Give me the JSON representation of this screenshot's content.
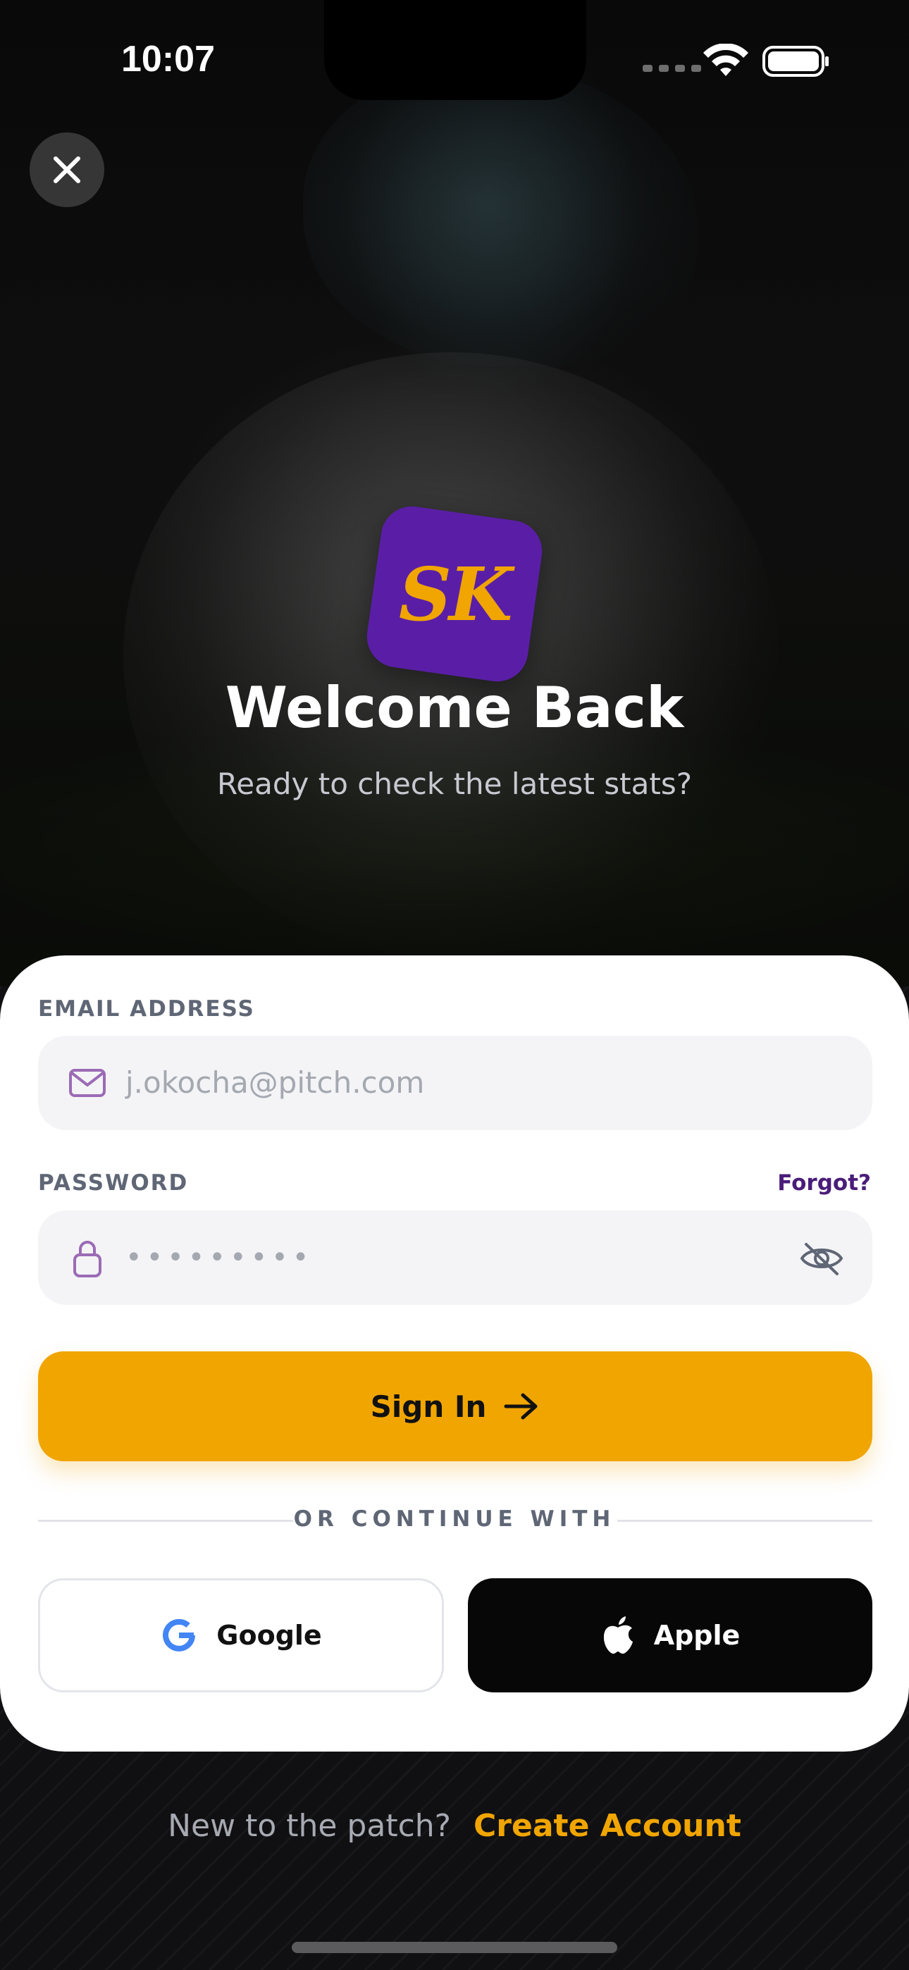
{
  "status_bar": {
    "time": "10:07"
  },
  "hero": {
    "logo_text": "SK",
    "title": "Welcome Back",
    "subtitle": "Ready to check the latest stats?"
  },
  "form": {
    "email_label": "EMAIL ADDRESS",
    "email_placeholder": "j.okocha@pitch.com",
    "password_label": "PASSWORD",
    "forgot_label": "Forgot?",
    "password_mask": "•••••••••",
    "signin_label": "Sign In",
    "divider_text": "OR CONTINUE WITH",
    "google_label": "Google",
    "apple_label": "Apple"
  },
  "footer": {
    "prompt": "New to the patch?",
    "link": "Create Account"
  },
  "colors": {
    "accent": "#f0a500",
    "brand_purple": "#5a1ea6",
    "forgot_purple": "#4a1d7a",
    "label_gray": "#5f6675"
  },
  "icons": {
    "close": "close-icon",
    "email": "mail-icon",
    "password": "lock-icon",
    "visibility": "eye-off-icon",
    "signin": "arrow-right-icon",
    "google": "google-icon",
    "apple": "apple-icon"
  }
}
